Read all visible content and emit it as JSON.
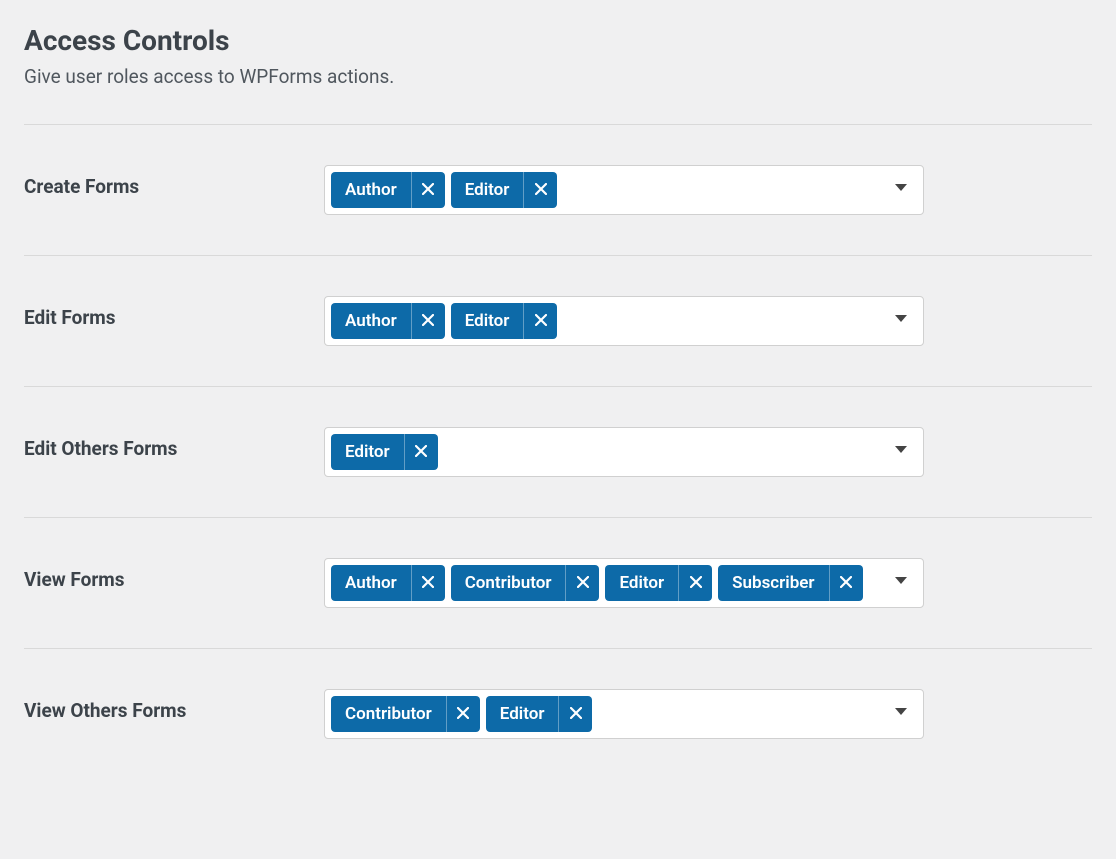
{
  "header": {
    "title": "Access Controls",
    "subtitle": "Give user roles access to WPForms actions."
  },
  "settings": [
    {
      "key": "create-forms",
      "label": "Create Forms",
      "roles": [
        "Author",
        "Editor"
      ]
    },
    {
      "key": "edit-forms",
      "label": "Edit Forms",
      "roles": [
        "Author",
        "Editor"
      ]
    },
    {
      "key": "edit-others-forms",
      "label": "Edit Others Forms",
      "roles": [
        "Editor"
      ]
    },
    {
      "key": "view-forms",
      "label": "View Forms",
      "roles": [
        "Author",
        "Contributor",
        "Editor",
        "Subscriber"
      ]
    },
    {
      "key": "view-others-forms",
      "label": "View Others Forms",
      "roles": [
        "Contributor",
        "Editor"
      ]
    }
  ]
}
